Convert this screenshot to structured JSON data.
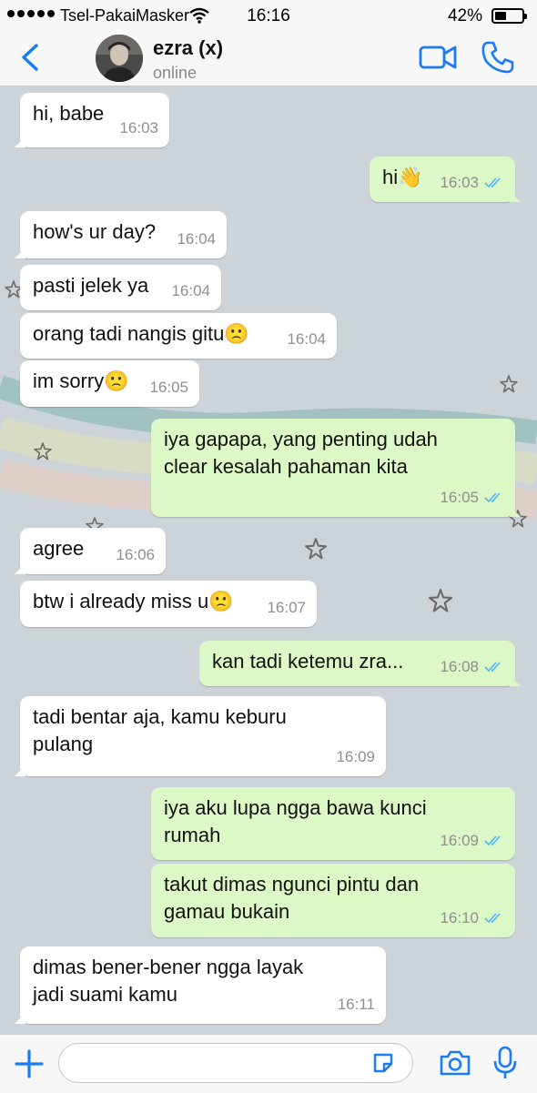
{
  "status_bar": {
    "carrier": "Tsel-PakaiMasker",
    "time": "16:16",
    "battery_percent": "42%",
    "battery_level": 0.42
  },
  "header": {
    "contact_name": "ezra (x)",
    "contact_status": "online",
    "accent_color": "#1a7cf5"
  },
  "messages": [
    {
      "direction": "in",
      "text": "hi, babe",
      "time": "16:03"
    },
    {
      "direction": "out",
      "text": "hi👋",
      "time": "16:03",
      "read": true
    },
    {
      "direction": "in",
      "text": "how's ur day?",
      "time": "16:04"
    },
    {
      "direction": "in",
      "text": "pasti jelek ya",
      "time": "16:04"
    },
    {
      "direction": "in",
      "text": "orang tadi nangis gitu🙁",
      "time": "16:04"
    },
    {
      "direction": "in",
      "text": "im sorry🙁",
      "time": "16:05"
    },
    {
      "direction": "out",
      "text": "iya gapapa, yang penting udah\nclear kesalah pahaman kita",
      "time": "16:05",
      "read": true
    },
    {
      "direction": "in",
      "text": "agree",
      "time": "16:06"
    },
    {
      "direction": "in",
      "text": "btw i already miss u🙁",
      "time": "16:07"
    },
    {
      "direction": "out",
      "text": "kan tadi ketemu zra...",
      "time": "16:08",
      "read": true
    },
    {
      "direction": "in",
      "text": "tadi bentar aja, kamu keburu\npulang",
      "time": "16:09"
    },
    {
      "direction": "out",
      "text": "iya aku lupa ngga bawa kunci\nrumah",
      "time": "16:09",
      "read": true
    },
    {
      "direction": "out",
      "text": "takut dimas ngunci pintu dan\ngamau bukain",
      "time": "16:10",
      "read": true
    },
    {
      "direction": "in",
      "text": "dimas bener-bener ngga layak\njadi suami kamu",
      "time": "16:11"
    }
  ],
  "input_bar": {
    "message_value": "",
    "message_placeholder": ""
  },
  "colors": {
    "incoming_bubble": "#ffffff",
    "outgoing_bubble": "#dcf8c6",
    "read_check": "#4fb3f6",
    "chat_background": "#cdd4d9"
  }
}
